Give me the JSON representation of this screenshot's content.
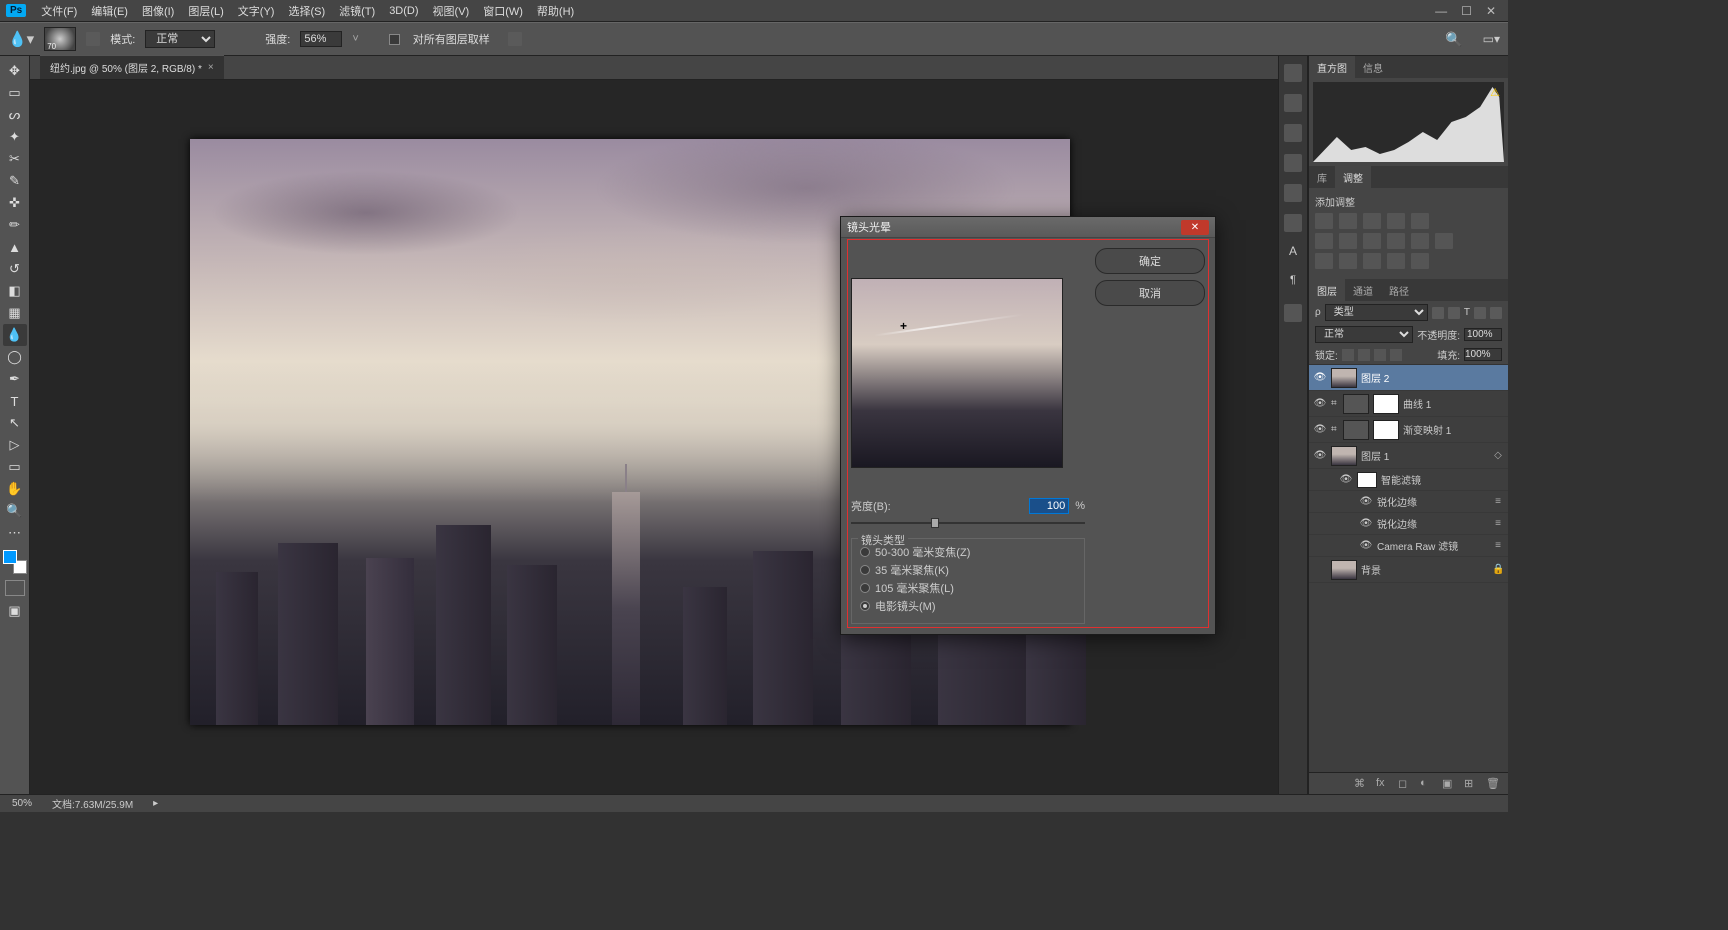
{
  "menubar": {
    "logo": "Ps",
    "items": [
      "文件(F)",
      "编辑(E)",
      "图像(I)",
      "图层(L)",
      "文字(Y)",
      "选择(S)",
      "滤镜(T)",
      "3D(D)",
      "视图(V)",
      "窗口(W)",
      "帮助(H)"
    ]
  },
  "options": {
    "mode_label": "模式:",
    "mode_value": "正常",
    "strength_label": "强度:",
    "strength_value": "56%",
    "sample_all_label": "对所有图层取样",
    "brush_size": "70"
  },
  "doc_tab": {
    "title": "纽约.jpg @ 50% (图层 2, RGB/8) *"
  },
  "status": {
    "zoom": "50%",
    "doc_info": "文档:7.63M/25.9M"
  },
  "panels": {
    "hist_tabs": [
      "直方图",
      "信息"
    ],
    "lib_tabs": [
      "库",
      "调整"
    ],
    "adjust_label": "添加调整",
    "layer_tabs": [
      "图层",
      "通道",
      "路径"
    ],
    "kind_label": "类型",
    "blend_mode": "正常",
    "opacity_label": "不透明度:",
    "opacity_value": "100%",
    "lock_label": "锁定:",
    "fill_label": "填充:",
    "fill_value": "100%",
    "layers": [
      {
        "name": "图层 2",
        "type": "pixel",
        "selected": true
      },
      {
        "name": "曲线 1",
        "type": "adj"
      },
      {
        "name": "渐变映射 1",
        "type": "adj"
      },
      {
        "name": "图层 1",
        "type": "smart",
        "expanded": true
      },
      {
        "name": "智能滤镜",
        "type": "smartfilters"
      },
      {
        "name": "锐化边缘",
        "type": "filter"
      },
      {
        "name": "锐化边缘",
        "type": "filter"
      },
      {
        "name": "Camera Raw 滤镜",
        "type": "filter"
      },
      {
        "name": "背景",
        "type": "bg",
        "locked": true
      }
    ]
  },
  "dialog": {
    "title": "镜头光晕",
    "ok": "确定",
    "cancel": "取消",
    "brightness_label": "亮度(B):",
    "brightness_value": "100",
    "brightness_unit": "%",
    "lens_type_label": "镜头类型",
    "lens_options": [
      {
        "label": "50-300 毫米变焦(Z)",
        "checked": false
      },
      {
        "label": "35 毫米聚焦(K)",
        "checked": false
      },
      {
        "label": "105 毫米聚焦(L)",
        "checked": false
      },
      {
        "label": "电影镜头(M)",
        "checked": true
      }
    ]
  }
}
